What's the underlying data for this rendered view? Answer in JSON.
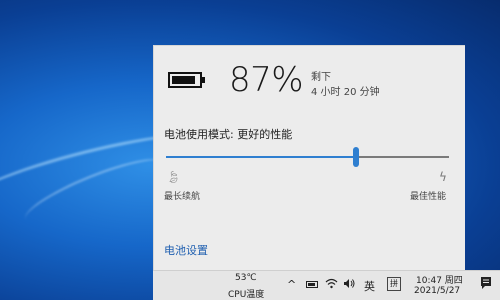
{
  "battery": {
    "percent_text": "87%",
    "level": 0.87,
    "remaining_label": "剩下",
    "remaining_time": "4 小时 20 分钟"
  },
  "power_mode": {
    "label": "电池使用模式: 更好的性能",
    "slider_value": 0.67,
    "left_label": "最长续航",
    "right_label": "最佳性能",
    "left_icon": "leaf-icon",
    "right_icon": "bolt-icon"
  },
  "settings_link": "电池设置",
  "taskbar": {
    "temperature": "53℃",
    "cpu_label": "CPU温度",
    "chevron": "^",
    "network_icon": "wifi-icon",
    "volume_icon": "speaker-icon",
    "language": "英",
    "ime": "拼",
    "time": "10:47 周四",
    "date": "2021/5/27",
    "notification_icon": "notification-icon"
  },
  "colors": {
    "accent": "#2f7fd0",
    "flyout_bg": "#ececec",
    "taskbar_bg": "#e6e6e6"
  }
}
